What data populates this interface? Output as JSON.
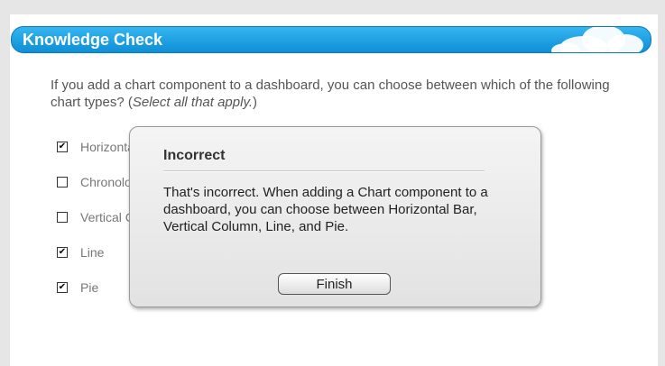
{
  "header": {
    "title": "Knowledge Check"
  },
  "question": {
    "text": "If you add a chart component to a dashboard, you can choose between which of the following chart types? (",
    "hint": "Select all that apply.",
    "suffix": ")"
  },
  "options": [
    {
      "label": "Horizontal Bar",
      "checked": true
    },
    {
      "label": "Chronological",
      "checked": false
    },
    {
      "label": "Vertical Column",
      "checked": false
    },
    {
      "label": "Line",
      "checked": true
    },
    {
      "label": "Pie",
      "checked": true
    }
  ],
  "dialog": {
    "title": "Incorrect",
    "message": "That's incorrect. When adding a Chart component to a dashboard, you can choose between Horizontal Bar, Vertical Column, Line, and Pie.",
    "button_label": "Finish"
  },
  "colors": {
    "header_blue": "#1a9de0"
  }
}
